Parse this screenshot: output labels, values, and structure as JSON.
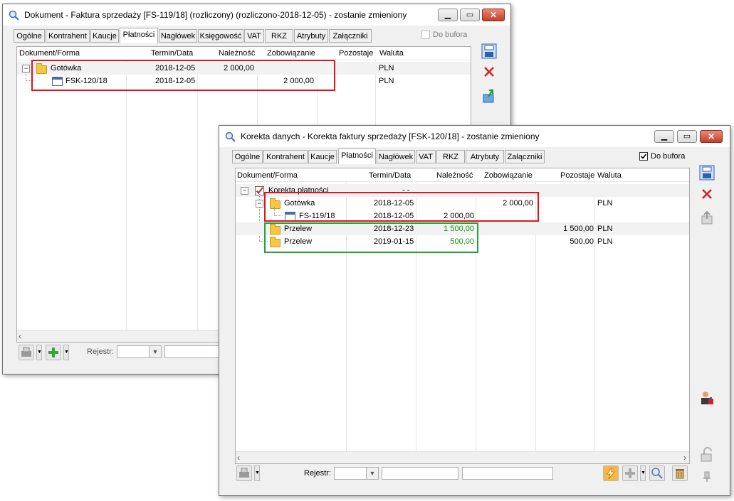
{
  "win1": {
    "title": "Dokument - Faktura sprzedaży [FS-119/18] (rozliczony) (rozliczono-2018-12-05) - zostanie zmieniony",
    "tabs": [
      "Ogólne",
      "Kontrahent",
      "Kaucje",
      "Płatności",
      "Nagłówek",
      "Księgowość",
      "VAT",
      "RKZ",
      "Atrybuty",
      "Załączniki"
    ],
    "active_tab": "Płatności",
    "do_bufora_label": "Do bufora",
    "do_bufora_checked": false,
    "columns": [
      "Dokument/Forma",
      "Termin/Data",
      "Należność",
      "Zobowiązanie",
      "Pozostaje",
      "Waluta"
    ],
    "rows": [
      {
        "name": "Gotówka",
        "date": "2018-12-05",
        "naleznosc": "2 000,00",
        "zobowiazanie": "",
        "pozostaje": "",
        "waluta": "PLN"
      },
      {
        "name": "FSK-120/18",
        "date": "2018-12-05",
        "naleznosc": "",
        "zobowiazanie": "2 000,00",
        "pozostaje": "",
        "waluta": "PLN"
      }
    ],
    "rejestr_label": "Rejestr:",
    "icons": [
      "save-icon",
      "delete-icon",
      "export-icon",
      "print-icon",
      "add-icon"
    ]
  },
  "win2": {
    "title": "Korekta danych - Korekta faktury sprzedaży [FSK-120/18]  - zostanie zmieniony",
    "tabs": [
      "Ogólne",
      "Kontrahent",
      "Kaucje",
      "Płatności",
      "Nagłówek",
      "VAT",
      "RKZ",
      "Atrybuty",
      "Załączniki"
    ],
    "active_tab": "Płatności",
    "do_bufora_label": "Do bufora",
    "do_bufora_checked": true,
    "columns": [
      "Dokument/Forma",
      "Termin/Data",
      "Należność",
      "Zobowiązanie",
      "Pozostaje",
      "Waluta"
    ],
    "root": {
      "name": "Korekta płatności",
      "date": "-  -"
    },
    "rows": [
      {
        "name": "Gotówka",
        "date": "2018-12-05",
        "naleznosc": "",
        "zobowiazanie": "2 000,00",
        "pozostaje": "",
        "waluta": "PLN"
      },
      {
        "name": "FS-119/18",
        "date": "2018-12-05",
        "naleznosc": "2 000,00",
        "zobowiazanie": "",
        "pozostaje": "",
        "waluta": "PLN"
      },
      {
        "name": "Przelew",
        "date": "2018-12-23",
        "naleznosc": "1 500,00",
        "zobowiazanie": "",
        "pozostaje": "1 500,00",
        "waluta": "PLN"
      },
      {
        "name": "Przelew",
        "date": "2019-01-15",
        "naleznosc": "500,00",
        "zobowiazanie": "",
        "pozostaje": "500,00",
        "waluta": "PLN"
      }
    ],
    "rejestr_label": "Rejestr:",
    "icons": [
      "save-icon",
      "delete-icon",
      "export-icon",
      "contractor-icon",
      "lock-icon",
      "pin-icon",
      "lightning-icon",
      "add-icon",
      "search-icon",
      "trash-icon",
      "print-icon"
    ]
  },
  "colors": {
    "highlight_red": "#e0141e",
    "highlight_green": "#22a33a",
    "value_green": "#1a8c1a"
  }
}
